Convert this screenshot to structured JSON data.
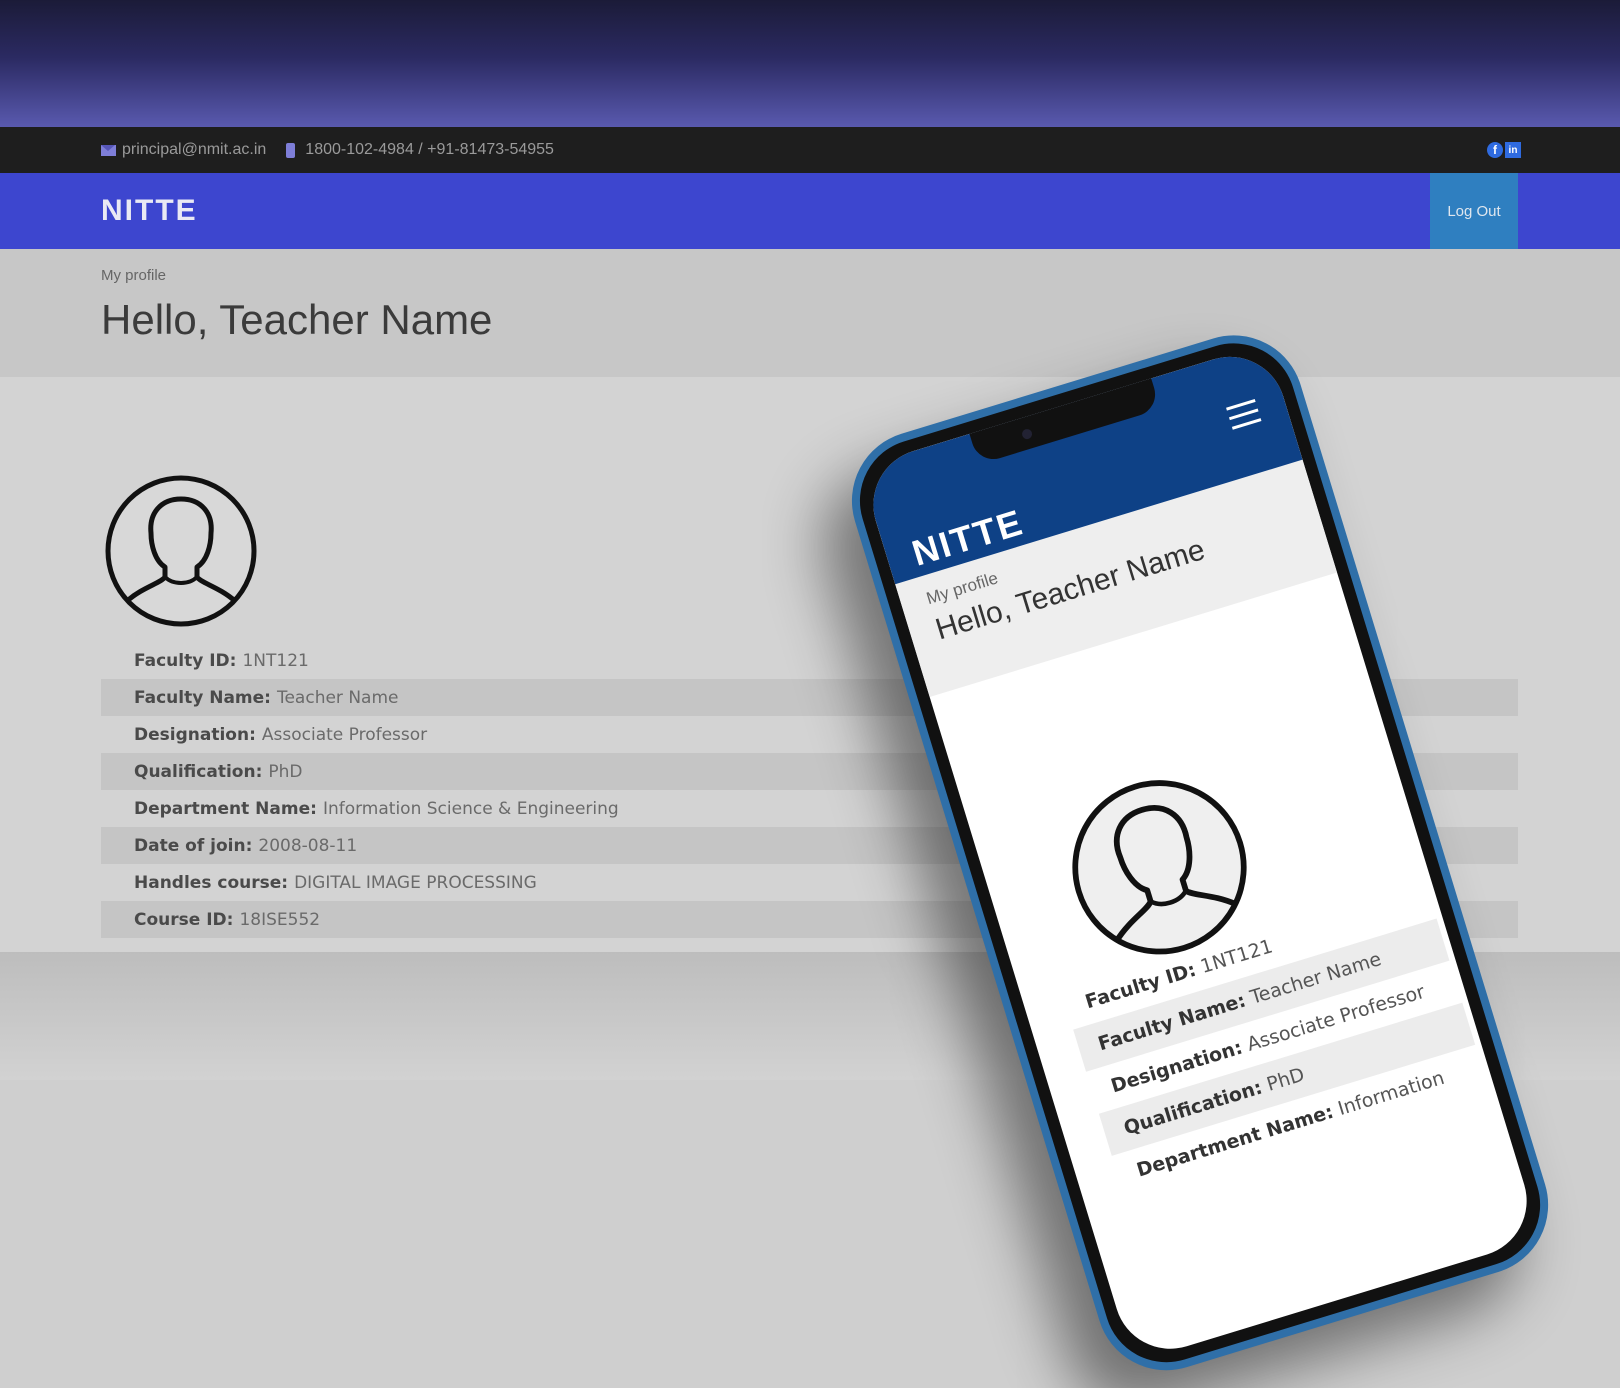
{
  "contact": {
    "email": "principal@nmit.ac.in",
    "phone": "1800-102-4984 / +91-81473-54955",
    "social_icons": [
      "facebook-icon",
      "linkedin-icon"
    ]
  },
  "nav": {
    "brand": "NITTE",
    "logout_label": "Log Out"
  },
  "page": {
    "breadcrumb": "My profile",
    "greeting": "Hello, Teacher Name"
  },
  "profile": [
    {
      "label": "Faculty ID:",
      "value": "1NT121"
    },
    {
      "label": "Faculty Name:",
      "value": "Teacher Name"
    },
    {
      "label": "Designation:",
      "value": "Associate Professor"
    },
    {
      "label": "Qualification:",
      "value": "PhD"
    },
    {
      "label": "Department Name:",
      "value": "Information Science & Engineering"
    },
    {
      "label": "Date of join:",
      "value": "2008-08-11"
    },
    {
      "label": "Handles course:",
      "value": "DIGITAL IMAGE PROCESSING"
    },
    {
      "label": "Course ID:",
      "value": "18ISE552"
    }
  ],
  "phone": {
    "brand": "NITTE",
    "breadcrumb": "My profile",
    "greeting": "Hello, Teacher Name",
    "rows": [
      {
        "label": "Faculty ID:",
        "value": "1NT121"
      },
      {
        "label": "Faculty Name:",
        "value": "Teacher Name"
      },
      {
        "label": "Designation:",
        "value": "Associate Professor"
      },
      {
        "label": "Qualification:",
        "value": "PhD"
      },
      {
        "label": "Department Name:",
        "value": "Information"
      }
    ]
  },
  "colors": {
    "navbar": "#3d46cf",
    "logout": "#2f7fc0",
    "phone_nav": "#0e4186",
    "phone_frame": "#2f6fa8"
  }
}
